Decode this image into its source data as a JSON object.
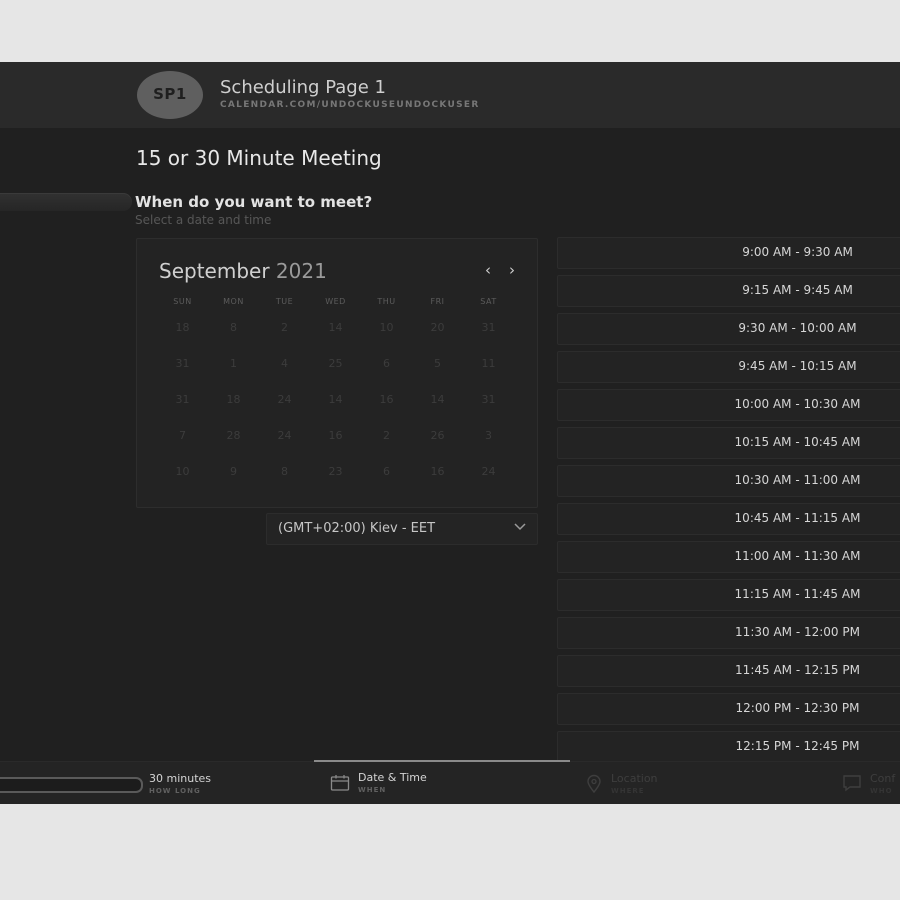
{
  "header": {
    "avatar_initials": "SP1",
    "page_name": "Scheduling Page 1",
    "page_url": "CALENDAR.COM/UNDOCKUSEUNDOCKUSER"
  },
  "meeting": {
    "title": "15 or 30 Minute Meeting",
    "question": "When do you want to meet?",
    "subtitle": "Select a date and time"
  },
  "calendar": {
    "month": "September",
    "year": "2021",
    "weekdays": [
      "SUN",
      "MON",
      "TUE",
      "WED",
      "THU",
      "FRI",
      "SAT"
    ],
    "weeks": [
      [
        "18",
        "8",
        "2",
        "14",
        "10",
        "20",
        "31"
      ],
      [
        "31",
        "1",
        "4",
        "25",
        "6",
        "5",
        "11"
      ],
      [
        "31",
        "18",
        "24",
        "14",
        "16",
        "14",
        "31"
      ],
      [
        "7",
        "28",
        "24",
        "16",
        "2",
        "26",
        "3"
      ],
      [
        "10",
        "9",
        "8",
        "23",
        "6",
        "16",
        "24"
      ]
    ],
    "prev_icon": "chevron-left-icon",
    "next_icon": "chevron-right-icon"
  },
  "timezone": {
    "selected": "(GMT+02:00) Kiev - EET",
    "icon": "chevron-down-icon"
  },
  "time_slots": [
    "9:00 AM - 9:30 AM",
    "9:15 AM - 9:45 AM",
    "9:30 AM - 10:00 AM",
    "9:45 AM - 10:15 AM",
    "10:00 AM - 10:30 AM",
    "10:15 AM - 10:45 AM",
    "10:30 AM - 11:00 AM",
    "10:45 AM - 11:15 AM",
    "11:00 AM - 11:30 AM",
    "11:15 AM - 11:45 AM",
    "11:30 AM - 12:00 PM",
    "11:45 AM - 12:15 PM",
    "12:00 PM - 12:30 PM",
    "12:15 PM - 12:45 PM"
  ],
  "footer": {
    "steps": [
      {
        "label": "30 minutes",
        "sub": "HOW LONG"
      },
      {
        "label": "Date & Time",
        "sub": "WHEN",
        "icon": "calendar-icon"
      },
      {
        "label": "Location",
        "sub": "WHERE",
        "icon": "location-pin-icon"
      },
      {
        "label": "Conf",
        "sub": "WHO",
        "icon": "comment-icon"
      }
    ]
  },
  "colors": {
    "background": "#202020",
    "header": "#2a2a2a",
    "accent": "#8a8a8a"
  }
}
